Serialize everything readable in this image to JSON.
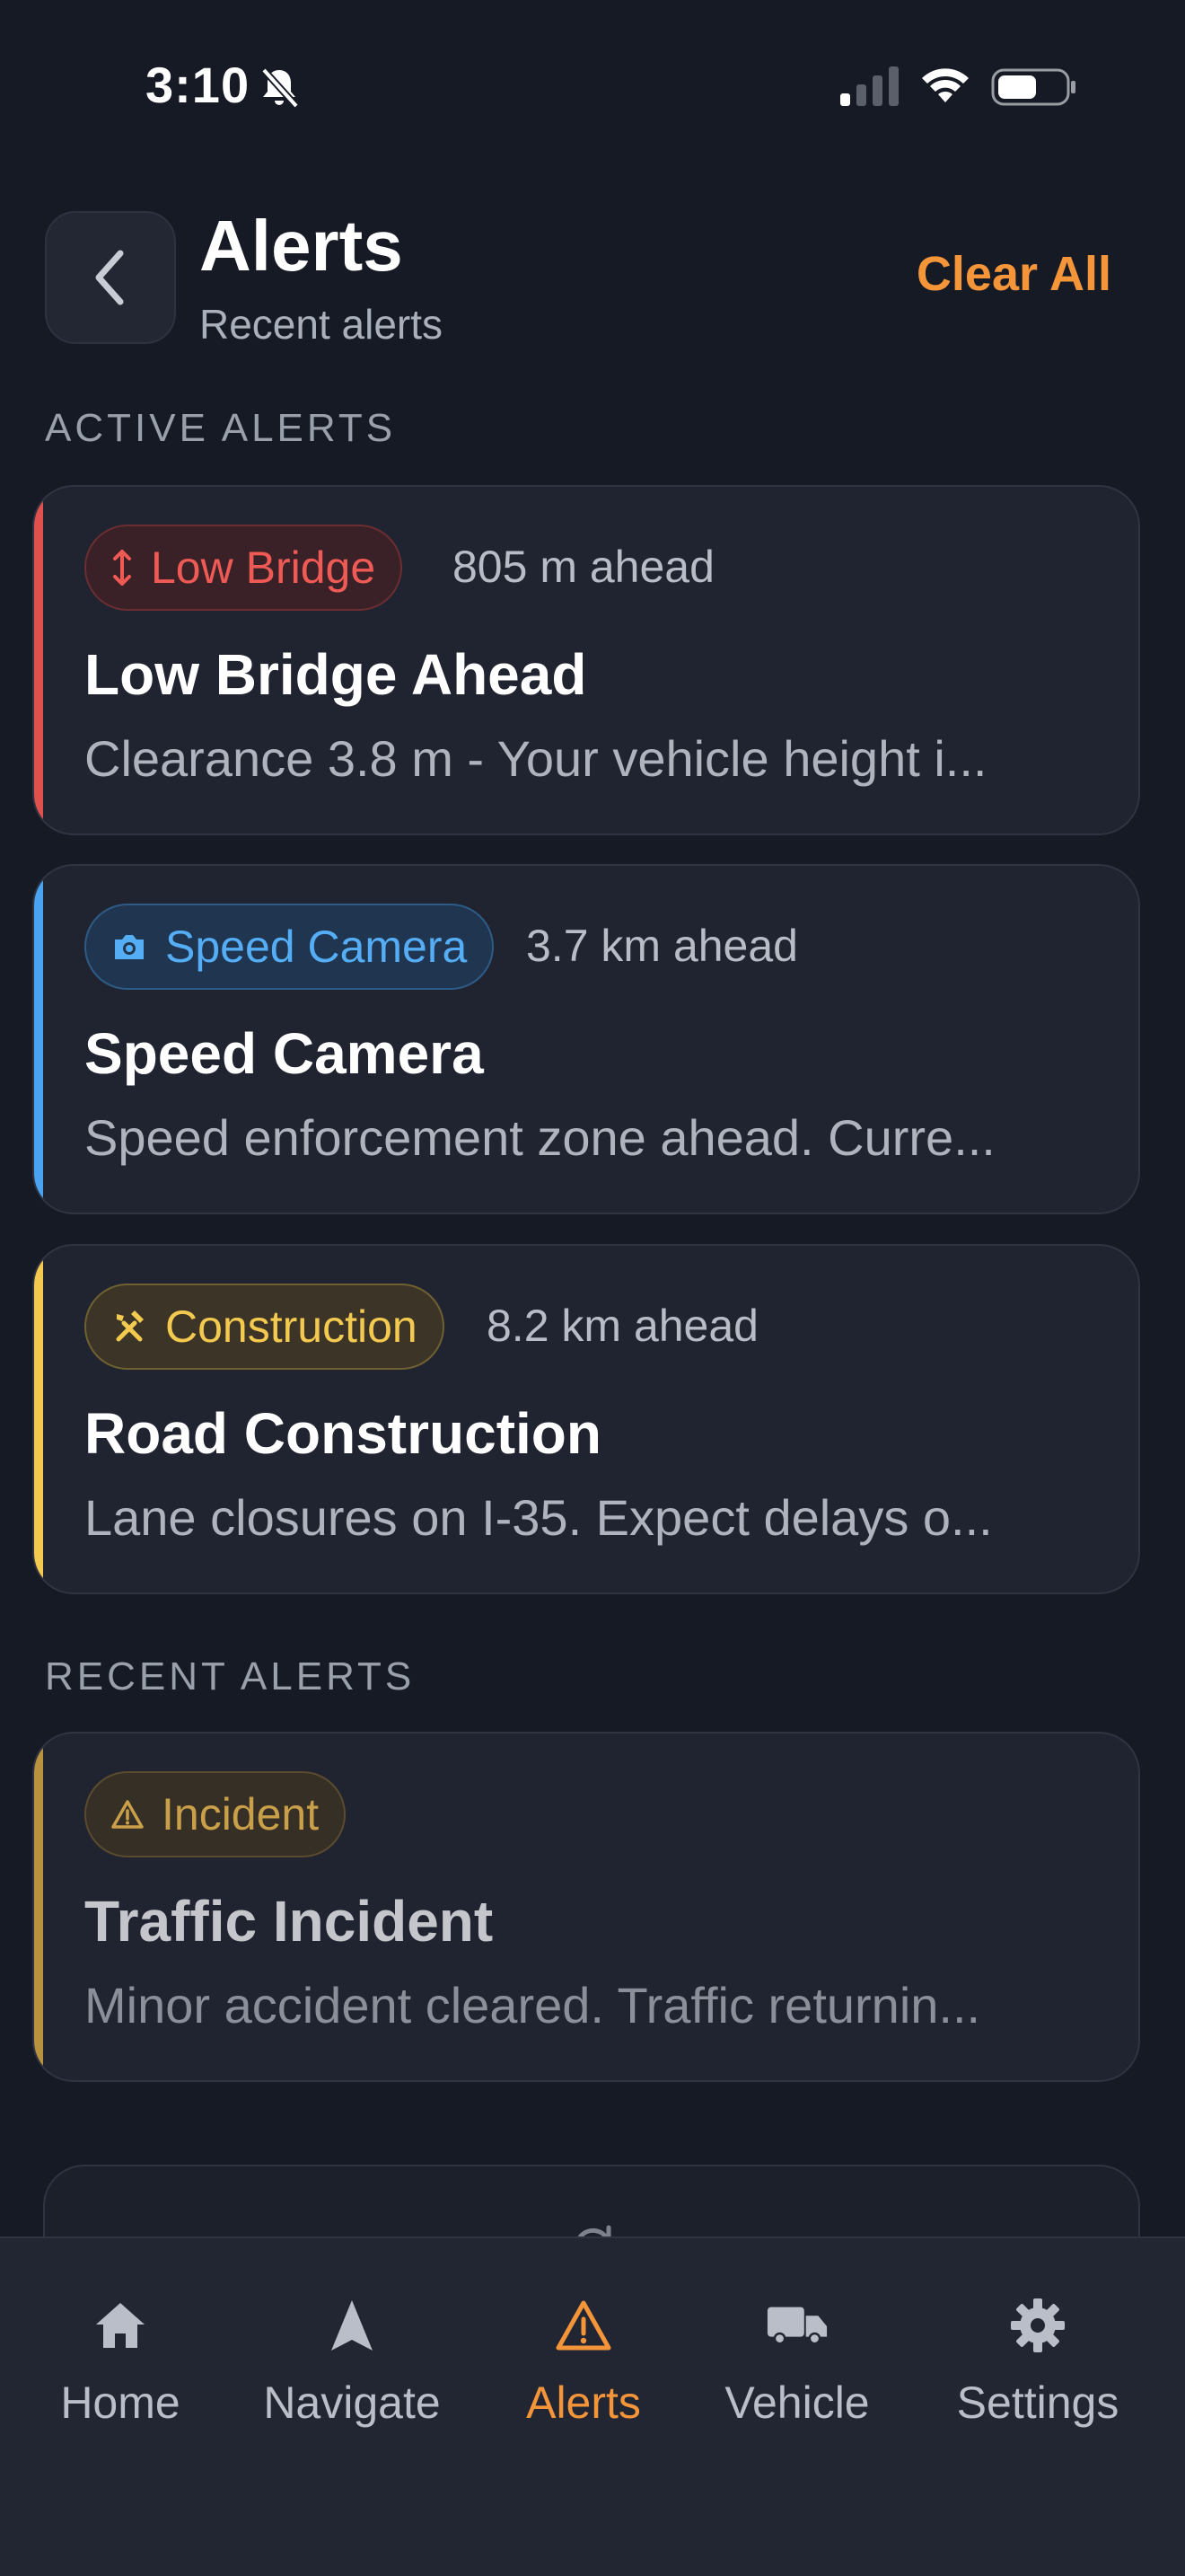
{
  "status_bar": {
    "time": "3:10"
  },
  "header": {
    "title": "Alerts",
    "subtitle": "Recent alerts",
    "clear_all_label": "Clear All"
  },
  "sections": {
    "active_label": "ACTIVE ALERTS",
    "recent_label": "RECENT ALERTS"
  },
  "active_alerts": [
    {
      "badge": "Low Bridge",
      "badge_icon": "height-arrow-icon",
      "distance": "805 m ahead",
      "title": "Low Bridge Ahead",
      "description": "Clearance 3.8 m - Your vehicle height i...",
      "color": "#e0504d"
    },
    {
      "badge": "Speed Camera",
      "badge_icon": "camera-icon",
      "distance": "3.7 km ahead",
      "title": "Speed Camera",
      "description": "Speed enforcement zone ahead. Curre...",
      "color": "#4aa3f0"
    },
    {
      "badge": "Construction",
      "badge_icon": "tools-icon",
      "distance": "8.2 km ahead",
      "title": "Road Construction",
      "description": "Lane closures on I-35. Expect delays o...",
      "color": "#f3c94f"
    }
  ],
  "recent_alerts": [
    {
      "badge": "Incident",
      "badge_icon": "warning-icon",
      "title": "Traffic Incident",
      "description": "Minor accident cleared. Traffic returnin...",
      "color": "#b8923e"
    }
  ],
  "tab_bar": {
    "tabs": [
      {
        "label": "Home",
        "icon": "home-icon"
      },
      {
        "label": "Navigate",
        "icon": "navigate-arrow-icon"
      },
      {
        "label": "Alerts",
        "icon": "alert-triangle-icon",
        "active": true
      },
      {
        "label": "Vehicle",
        "icon": "truck-icon"
      },
      {
        "label": "Settings",
        "icon": "gear-icon"
      }
    ],
    "active_color": "#f5953a",
    "inactive_color": "#b9bec8"
  }
}
